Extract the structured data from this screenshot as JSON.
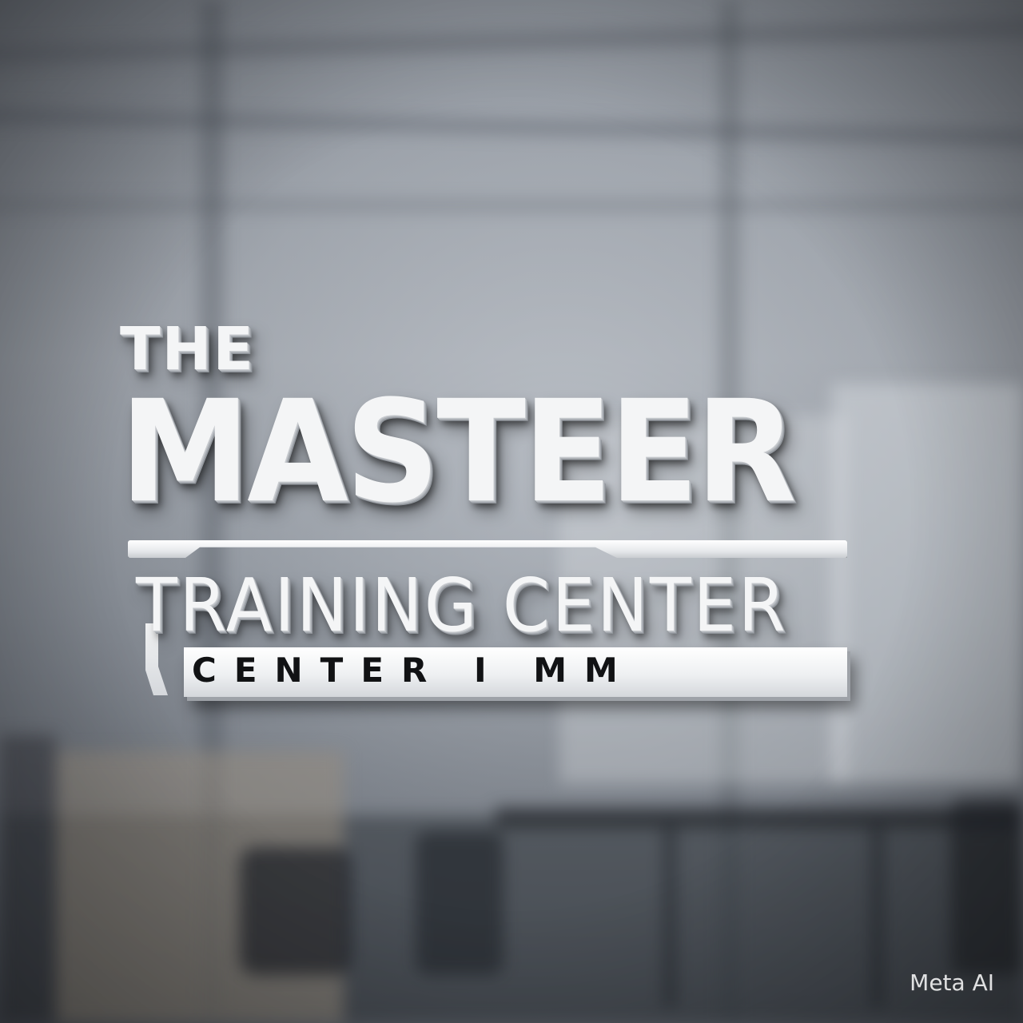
{
  "sign": {
    "line_the": "THE",
    "line_main": "MASTEER",
    "line_sub": "TRAINING CENTER",
    "plate_text": "CENTER I MM"
  },
  "watermark": {
    "text": "Meta AI"
  },
  "colors": {
    "letters": "#f4f5f6",
    "plate_text": "#111214",
    "background": "#8a9099"
  }
}
